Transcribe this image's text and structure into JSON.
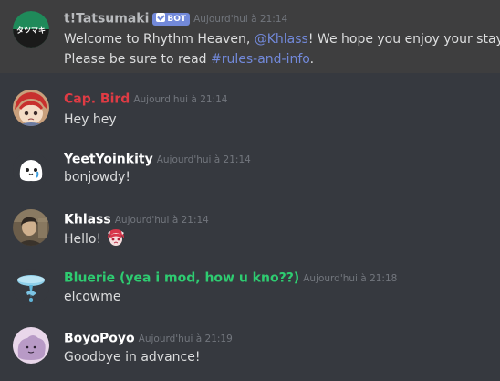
{
  "messages": [
    {
      "author": "t!Tatsumaki",
      "author_color": "#b9bbbe",
      "bot_badge": "BOT",
      "timestamp": "Aujourd'hui à 21:14",
      "avatar_text": "タツマキ",
      "line1_pre": "Welcome to Rhythm Heaven, ",
      "mention": "@Khlass",
      "line1_post": "! We hope you enjoy your stay.",
      "line2_pre": "Please be sure to read ",
      "channel": "#rules-and-info",
      "line2_post": "."
    },
    {
      "author": "Cap. Bird",
      "author_color": "#e03b44",
      "timestamp": "Aujourd'hui à 21:14",
      "text": "Hey hey"
    },
    {
      "author": "YeetYoinkity",
      "author_color": "#ffffff",
      "timestamp": "Aujourd'hui à 21:14",
      "text": "bonjowdy!"
    },
    {
      "author": "Khlass",
      "author_color": "#ffffff",
      "timestamp": "Aujourd'hui à 21:14",
      "text": "Hello!",
      "emoji": "anime-girl-emoji"
    },
    {
      "author": "Bluerie (yea i mod, how u kno??)",
      "author_color": "#2ecc71",
      "timestamp": "Aujourd'hui à 21:18",
      "text": "elcowme"
    },
    {
      "author": "BoyoPoyo",
      "author_color": "#ffffff",
      "timestamp": "Aujourd'hui à 21:19",
      "text": "Goodbye in advance!"
    }
  ]
}
